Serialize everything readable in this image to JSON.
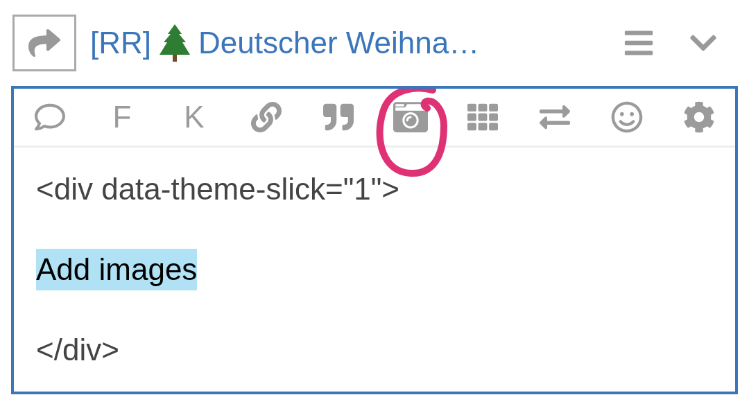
{
  "header": {
    "title_prefix": "[RR]",
    "title": "Deutscher Weihna…"
  },
  "toolbar": [
    {
      "kind": "speech"
    },
    {
      "kind": "letter",
      "label": "F"
    },
    {
      "kind": "letter",
      "label": "K"
    },
    {
      "kind": "link"
    },
    {
      "kind": "quote"
    },
    {
      "kind": "camera"
    },
    {
      "kind": "grid"
    },
    {
      "kind": "swap"
    },
    {
      "kind": "smiley"
    },
    {
      "kind": "gear"
    }
  ],
  "editor": {
    "lines": [
      {
        "text": "<div data-theme-slick=\"1\">",
        "highlighted": false
      },
      {
        "text": "Add images",
        "highlighted": true
      },
      {
        "text": "</div>",
        "highlighted": false
      }
    ]
  }
}
